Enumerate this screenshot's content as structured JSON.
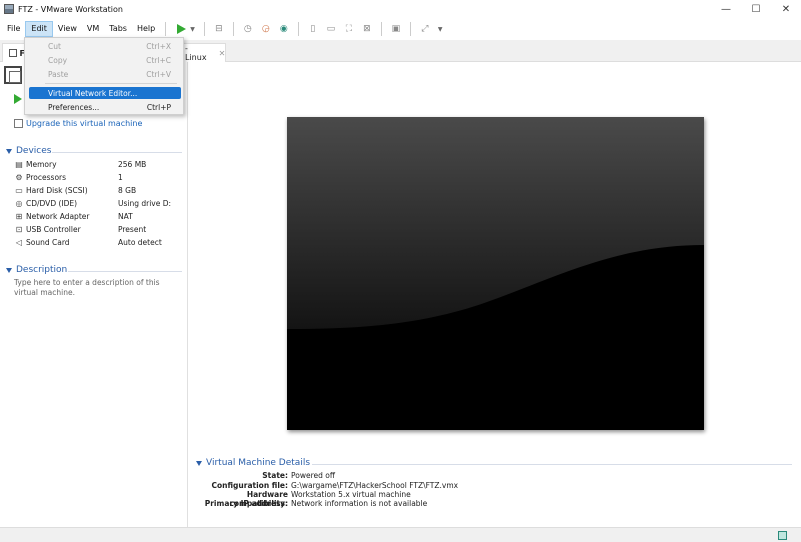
{
  "window": {
    "title": "FTZ - VMware Workstation",
    "controls": {
      "minimize": "—",
      "maximize": "☐",
      "close": "✕"
    }
  },
  "menu": {
    "items": [
      "File",
      "Edit",
      "View",
      "VM",
      "Tabs",
      "Help"
    ]
  },
  "edit_menu": {
    "items": [
      {
        "label": "Cut",
        "shortcut": "Ctrl+X",
        "disabled": true
      },
      {
        "label": "Copy",
        "shortcut": "Ctrl+C",
        "disabled": true
      },
      {
        "label": "Paste",
        "shortcut": "Ctrl+V",
        "disabled": true
      },
      {
        "label": "Virtual Network Editor...",
        "shortcut": "",
        "highlighted": true
      },
      {
        "label": "Preferences...",
        "shortcut": "Ctrl+P"
      }
    ]
  },
  "tabs": {
    "home_label": "F",
    "vm_tab_label": "-Linux",
    "close_glyph": "✕"
  },
  "commands": {
    "upgrade": "Upgrade this virtual machine"
  },
  "devices": {
    "header": "Devices",
    "rows": [
      {
        "icon": "memory-icon",
        "name": "Memory",
        "value": "256 MB"
      },
      {
        "icon": "processor-icon",
        "name": "Processors",
        "value": "1"
      },
      {
        "icon": "hard-disk-icon",
        "name": "Hard Disk (SCSI)",
        "value": "8 GB"
      },
      {
        "icon": "cd-dvd-icon",
        "name": "CD/DVD (IDE)",
        "value": "Using drive D:"
      },
      {
        "icon": "network-adapter-icon",
        "name": "Network Adapter",
        "value": "NAT"
      },
      {
        "icon": "usb-icon",
        "name": "USB Controller",
        "value": "Present"
      },
      {
        "icon": "sound-icon",
        "name": "Sound Card",
        "value": "Auto detect"
      }
    ]
  },
  "description": {
    "header": "Description",
    "placeholder": "Type here to enter a description of this virtual machine."
  },
  "vm_details": {
    "header": "Virtual Machine Details",
    "rows": [
      {
        "label": "State:",
        "value": "Powered off"
      },
      {
        "label": "Configuration file:",
        "value": "G:\\wargame\\FTZ\\HackerSchool FTZ\\FTZ.vmx"
      },
      {
        "label": "Hardware compatibility:",
        "value": "Workstation 5.x virtual machine"
      },
      {
        "label": "Primary IP address:",
        "value": "Network information is not available"
      }
    ]
  },
  "colors": {
    "accent": "#2a5ea8",
    "highlight": "#1a74d0",
    "play": "#33aa33"
  }
}
